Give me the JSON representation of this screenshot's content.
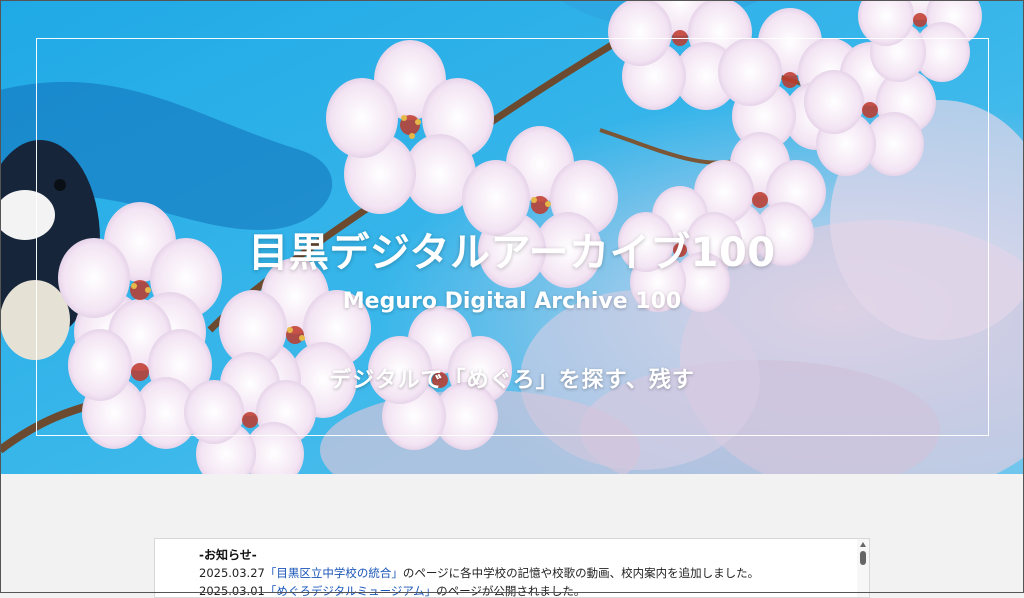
{
  "hero": {
    "title": "目黒デジタルアーカイブ100",
    "subtitle": "Meguro Digital Archive 100",
    "tagline": "デジタルで「めぐろ」を探す、残す",
    "image_alt": "cherry-blossom-and-bird-photo"
  },
  "news": {
    "heading": "-お知らせ-",
    "items": [
      {
        "date": "2025.03.27",
        "link_text": "「目黒区立中学校の統合」",
        "text": "のページに各中学校の記憶や校歌の動画、校内案内を追加しました。"
      },
      {
        "date": "2025.03.01",
        "link_text": "「めぐろデジタルミュージアム」",
        "text": "のページが公開されました。"
      }
    ]
  },
  "colors": {
    "sky": "#27b4e8",
    "blossom": "#f4e8f4",
    "link": "#1a56b8",
    "page_background": "#f2f2f2"
  }
}
